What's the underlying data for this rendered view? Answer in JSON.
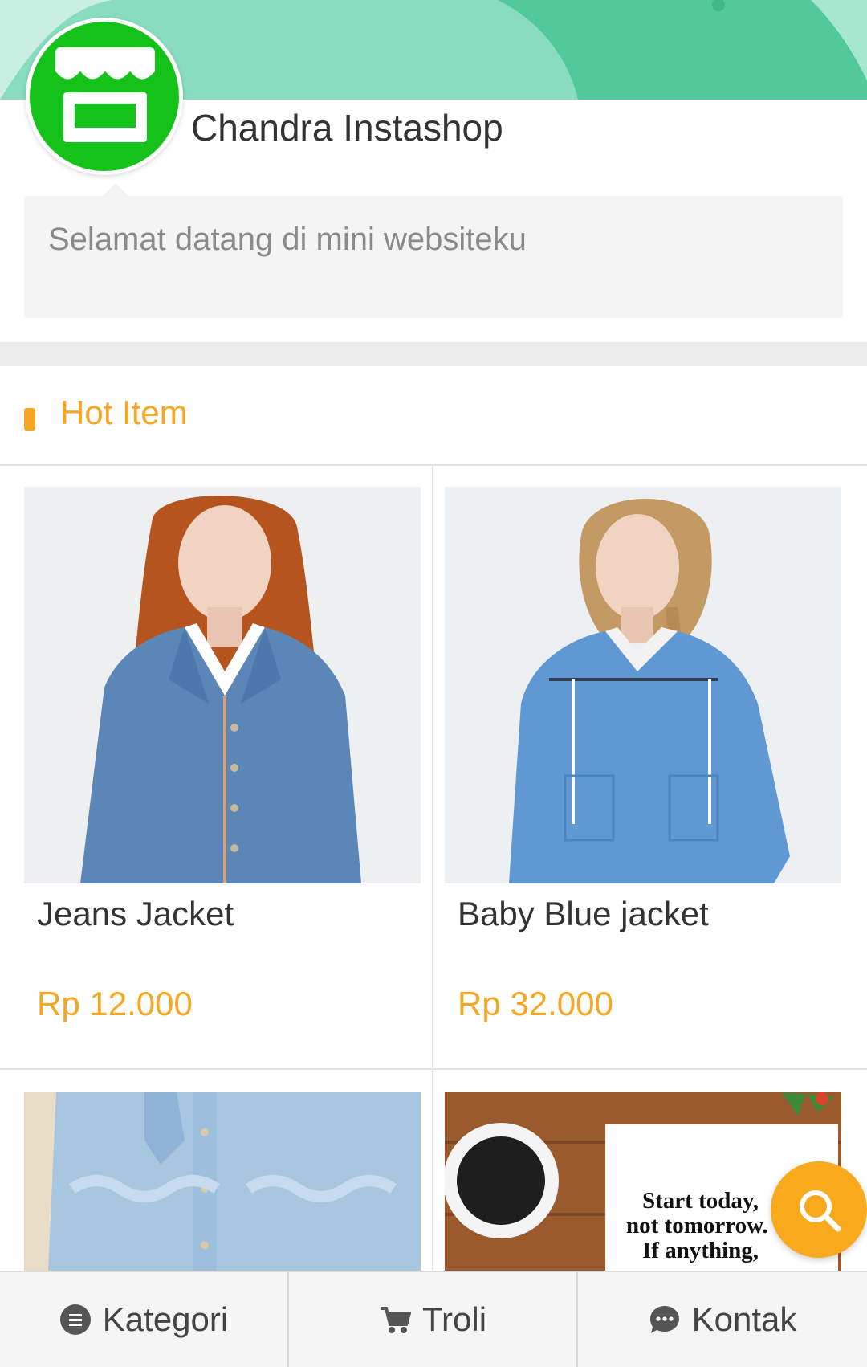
{
  "shop": {
    "name": "Chandra Instashop",
    "welcome": "Selamat datang di mini websiteku",
    "avatar_icon": "storefront-icon",
    "brand_green": "#15c21a",
    "banner_teal": "#7fd8b8"
  },
  "section": {
    "title": "Hot Item",
    "accent": "#f5a623"
  },
  "products": [
    {
      "title": "Jeans Jacket",
      "price": "Rp 12.000"
    },
    {
      "title": "Baby Blue jacket",
      "price": "Rp 32.000"
    },
    {
      "title": "",
      "price": ""
    },
    {
      "title": "",
      "price": ""
    }
  ],
  "poster_text": [
    "Start today,",
    "not tomorrow.",
    "If anything,"
  ],
  "fab": {
    "icon": "search-icon",
    "color": "#f8a91c"
  },
  "bottom_nav": [
    {
      "label": "Kategori",
      "icon": "list-icon"
    },
    {
      "label": "Troli",
      "icon": "cart-icon"
    },
    {
      "label": "Kontak",
      "icon": "chat-icon"
    }
  ]
}
